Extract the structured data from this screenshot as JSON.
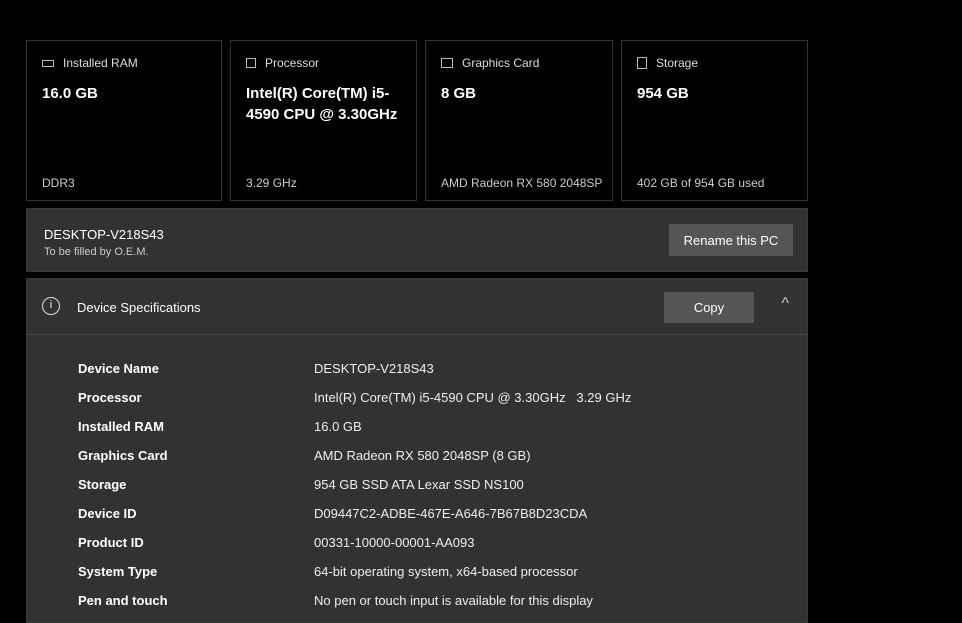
{
  "cards": [
    {
      "label": "Installed RAM",
      "icon": "memory-icon",
      "value": "16.0 GB",
      "sub": "DDR3"
    },
    {
      "label": "Processor",
      "icon": "cpu-icon",
      "value": "Intel(R) Core(TM) i5-4590 CPU @ 3.30GHz",
      "sub": "3.29 GHz"
    },
    {
      "label": "Graphics Card",
      "icon": "gpu-icon",
      "value": "8 GB",
      "sub": "AMD Radeon RX 580 2048SP"
    },
    {
      "label": "Storage",
      "icon": "storage-icon",
      "value": "954 GB",
      "sub": "402 GB of 954 GB used"
    }
  ],
  "pc": {
    "name": "DESKTOP-V218S43",
    "oem": "To be filled by O.E.M.",
    "rename_label": "Rename this PC"
  },
  "specs": {
    "title": "Device Specifications",
    "copy_label": "Copy",
    "info_glyph": "i",
    "chevron": "^",
    "rows": [
      {
        "k": "Device Name",
        "v": "DESKTOP-V218S43"
      },
      {
        "k": "Processor",
        "v": "Intel(R) Core(TM) i5-4590 CPU @ 3.30GHz   3.29 GHz"
      },
      {
        "k": "Installed RAM",
        "v": "16.0 GB"
      },
      {
        "k": "Graphics Card",
        "v": "AMD Radeon RX 580 2048SP (8 GB)"
      },
      {
        "k": "Storage",
        "v": "954 GB SSD ATA Lexar SSD NS100"
      },
      {
        "k": "Device ID",
        "v": "D09447C2-ADBE-467E-A646-7B67B8D23CDA"
      },
      {
        "k": "Product ID",
        "v": "00331-10000-00001-AA093"
      },
      {
        "k": "System Type",
        "v": "64-bit operating system, x64-based processor"
      },
      {
        "k": "Pen and touch",
        "v": "No pen or touch input is available for this display"
      }
    ]
  }
}
